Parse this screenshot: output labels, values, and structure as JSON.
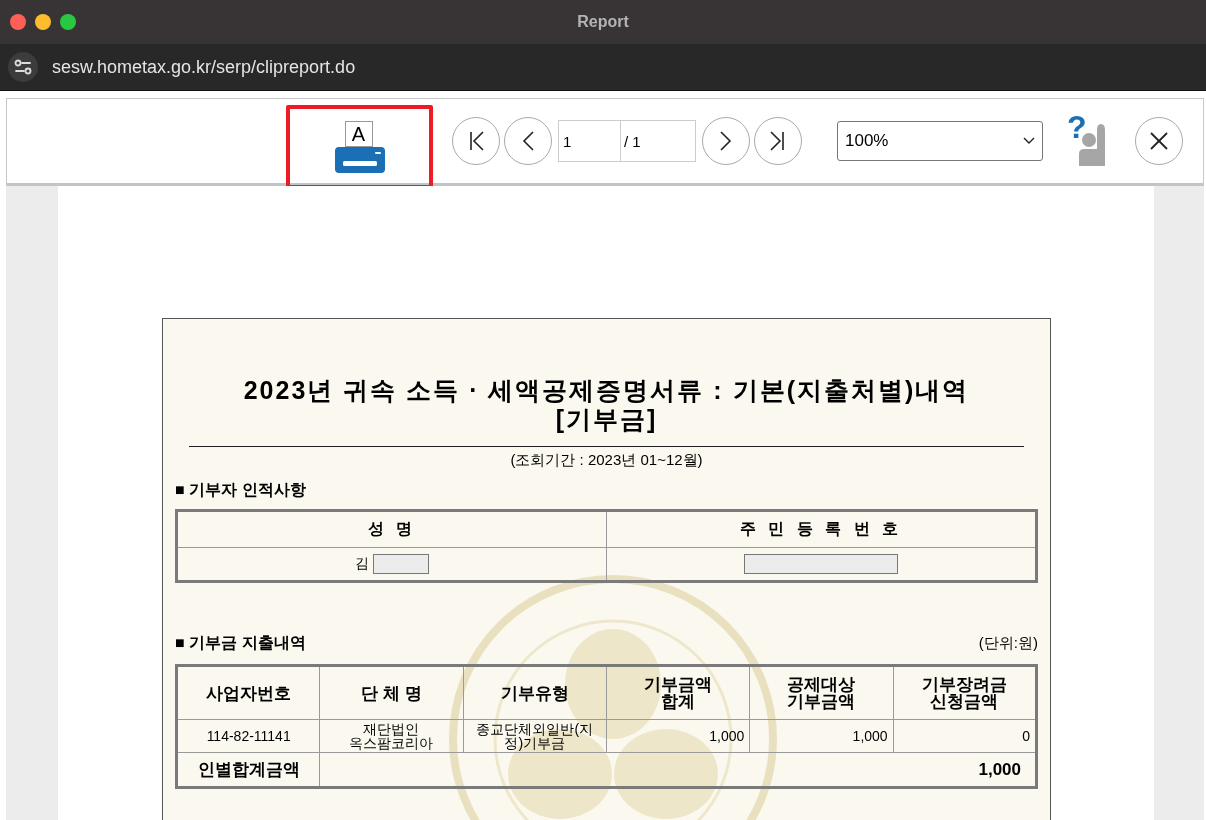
{
  "window": {
    "title": "Report"
  },
  "address_bar": {
    "url": "sesw.hometax.go.kr/serp/clipreport.do"
  },
  "toolbar": {
    "print_button": {
      "glyph": "A",
      "highlighted": true
    },
    "page_field": {
      "value": "1",
      "total": "/ 1"
    },
    "zoom_select": {
      "value": "100%"
    },
    "help_button": {
      "glyph": "?"
    }
  },
  "document": {
    "title_lines": [
      "2023년 귀속 소득 · 세액공제증명서류 : 기본(지출처별)내역",
      "[기부금]"
    ],
    "period": "(조회기간 : 2023년 01~12월)",
    "donor_section": {
      "title": "■ 기부자 인적사항",
      "columns": [
        "성 명",
        "주 민 등 록 번 호"
      ],
      "values": [
        {
          "text": "김",
          "redacted": true
        },
        {
          "redacted": true
        }
      ]
    },
    "donation_section": {
      "title": "■ 기부금 지출내역",
      "unit": "(단위:원)",
      "columns": [
        "사업자번호",
        "단 체 명",
        "기부유형",
        "기부금액\n합계",
        "공제대상\n기부금액",
        "기부장려금\n신청금액"
      ],
      "rows": [
        [
          "114-82-11141",
          "재단법인\n옥스팜코리아",
          "종교단체외일반(지\n정)기부금",
          "1,000",
          "1,000",
          "0"
        ]
      ],
      "total": {
        "label": "인별합계금액",
        "value": "1,000"
      }
    }
  }
}
